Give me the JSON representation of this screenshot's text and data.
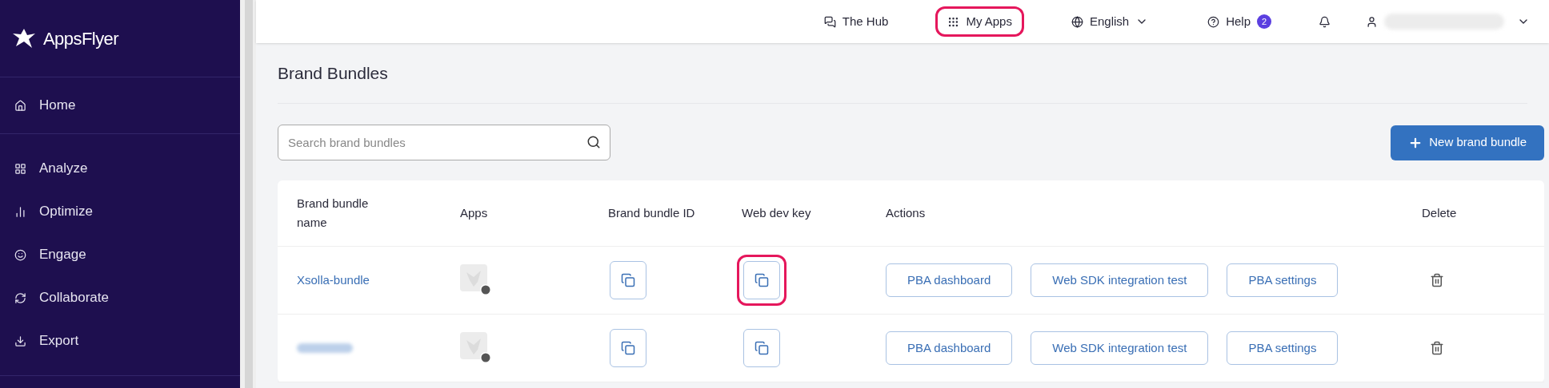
{
  "sidebar": {
    "logo": "AppsFlyer",
    "sections": [
      {
        "items": [
          {
            "label": "Home",
            "kind": "home"
          }
        ]
      },
      {
        "items": [
          {
            "label": "Analyze",
            "kind": "analyze"
          },
          {
            "label": "Optimize",
            "kind": "optimize"
          },
          {
            "label": "Engage",
            "kind": "engage"
          },
          {
            "label": "Collaborate",
            "kind": "collaborate"
          },
          {
            "label": "Export",
            "kind": "export"
          }
        ]
      }
    ]
  },
  "topbar": {
    "items": [
      {
        "label": "The Hub",
        "kind": "hub",
        "highlighted": false
      },
      {
        "label": "My Apps",
        "kind": "apps",
        "highlighted": true
      },
      {
        "label": "English",
        "kind": "language",
        "highlighted": false
      },
      {
        "label": "Help",
        "kind": "help",
        "badge": "2",
        "highlighted": false
      }
    ]
  },
  "page": {
    "title": "Brand Bundles",
    "search": {
      "placeholder": "Search brand bundles"
    },
    "new_button": "New brand bundle"
  },
  "table": {
    "columns": [
      "Brand bundle name",
      "Apps",
      "Brand bundle ID",
      "Web dev key",
      "Actions",
      "Delete"
    ],
    "rows": [
      {
        "name": "Xsolla-bundle",
        "name_blurred": false,
        "key_highlighted": true,
        "actions": [
          "PBA dashboard",
          "Web SDK integration test",
          "PBA settings"
        ]
      },
      {
        "name_blurred": true,
        "key_highlighted": false,
        "actions": [
          "PBA dashboard",
          "Web SDK integration test",
          "PBA settings"
        ]
      }
    ]
  }
}
